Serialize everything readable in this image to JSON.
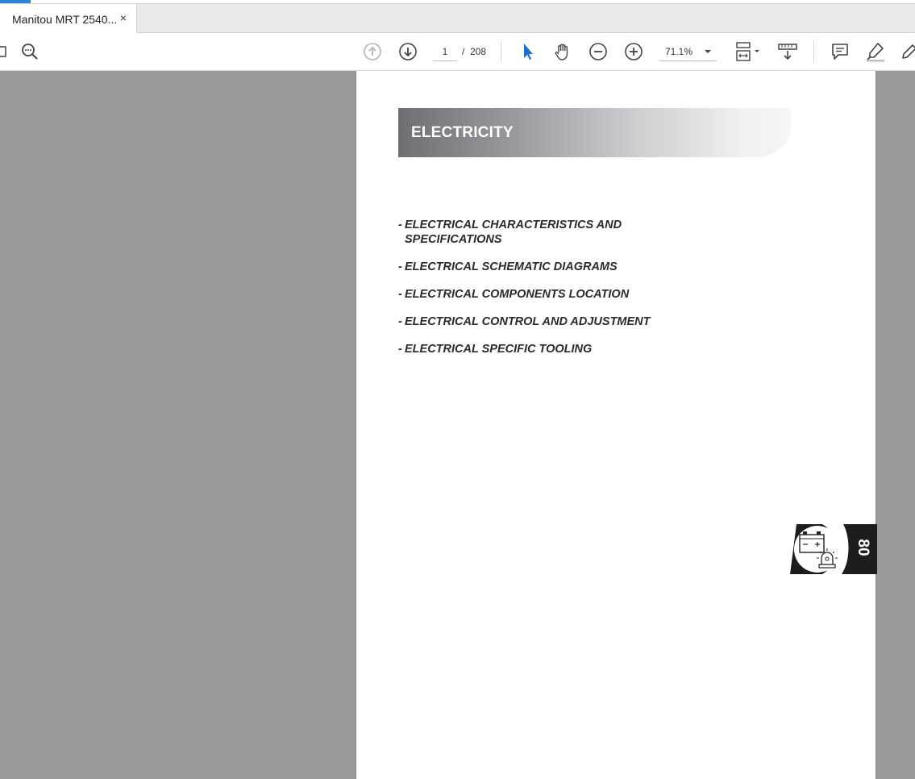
{
  "tab": {
    "title": "Manitou MRT 2540...",
    "close": "×"
  },
  "toolbar": {
    "current_page": "1",
    "separator": "/",
    "total_pages": "208",
    "zoom": "71.1%"
  },
  "document": {
    "banner_title": "ELECTRICITY",
    "toc": [
      {
        "dash": "-",
        "text": "ELECTRICAL CHARACTERISTICS AND",
        "text2": "SPECIFICATIONS"
      },
      {
        "dash": "-",
        "text": "ELECTRICAL SCHEMATIC DIAGRAMS"
      },
      {
        "dash": "-",
        "text": "ELECTRICAL COMPONENTS LOCATION"
      },
      {
        "dash": "-",
        "text": "ELECTRICAL CONTROL AND ADJUSTMENT"
      },
      {
        "dash": "-",
        "text": "ELECTRICAL SPECIFIC TOOLING"
      }
    ],
    "section_number": "80"
  },
  "colors": {
    "accent": "#2b86d9",
    "viewer_bg": "#999999",
    "select_tool": "#1f6fd1"
  }
}
